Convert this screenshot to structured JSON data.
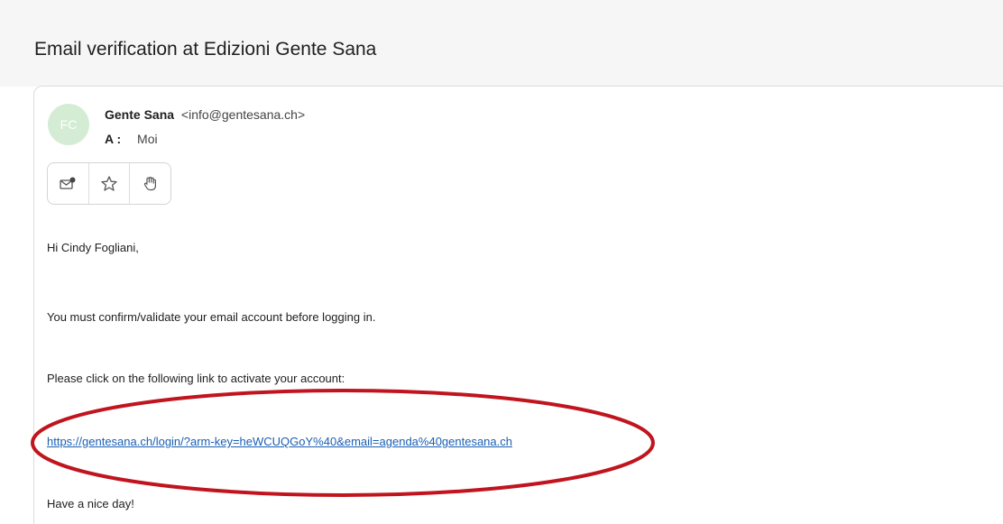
{
  "email": {
    "subject": "Email verification at Edizioni Gente Sana",
    "sender": {
      "avatar_initials": "FC",
      "name": "Gente Sana",
      "address": "<info@gentesana.ch>"
    },
    "recipient": {
      "label": "A :",
      "value": "Moi"
    },
    "actions": [
      {
        "name": "mark-unread",
        "icon": "envelope-dot-icon"
      },
      {
        "name": "star",
        "icon": "star-icon"
      },
      {
        "name": "flag",
        "icon": "hand-icon"
      }
    ],
    "body": {
      "greeting": "Hi Cindy Fogliani,",
      "line1": "You must confirm/validate your email account before logging in.",
      "line2": "Please click on the following link to activate your account:",
      "link": "https://gentesana.ch/login/?arm-key=heWCUQGoY%40&email=agenda%40gentesana.ch",
      "closing": "Have a nice day!"
    }
  },
  "colors": {
    "avatar_bg": "#d4ecd4",
    "link": "#1a5fb4",
    "highlight": "#c0141e"
  }
}
